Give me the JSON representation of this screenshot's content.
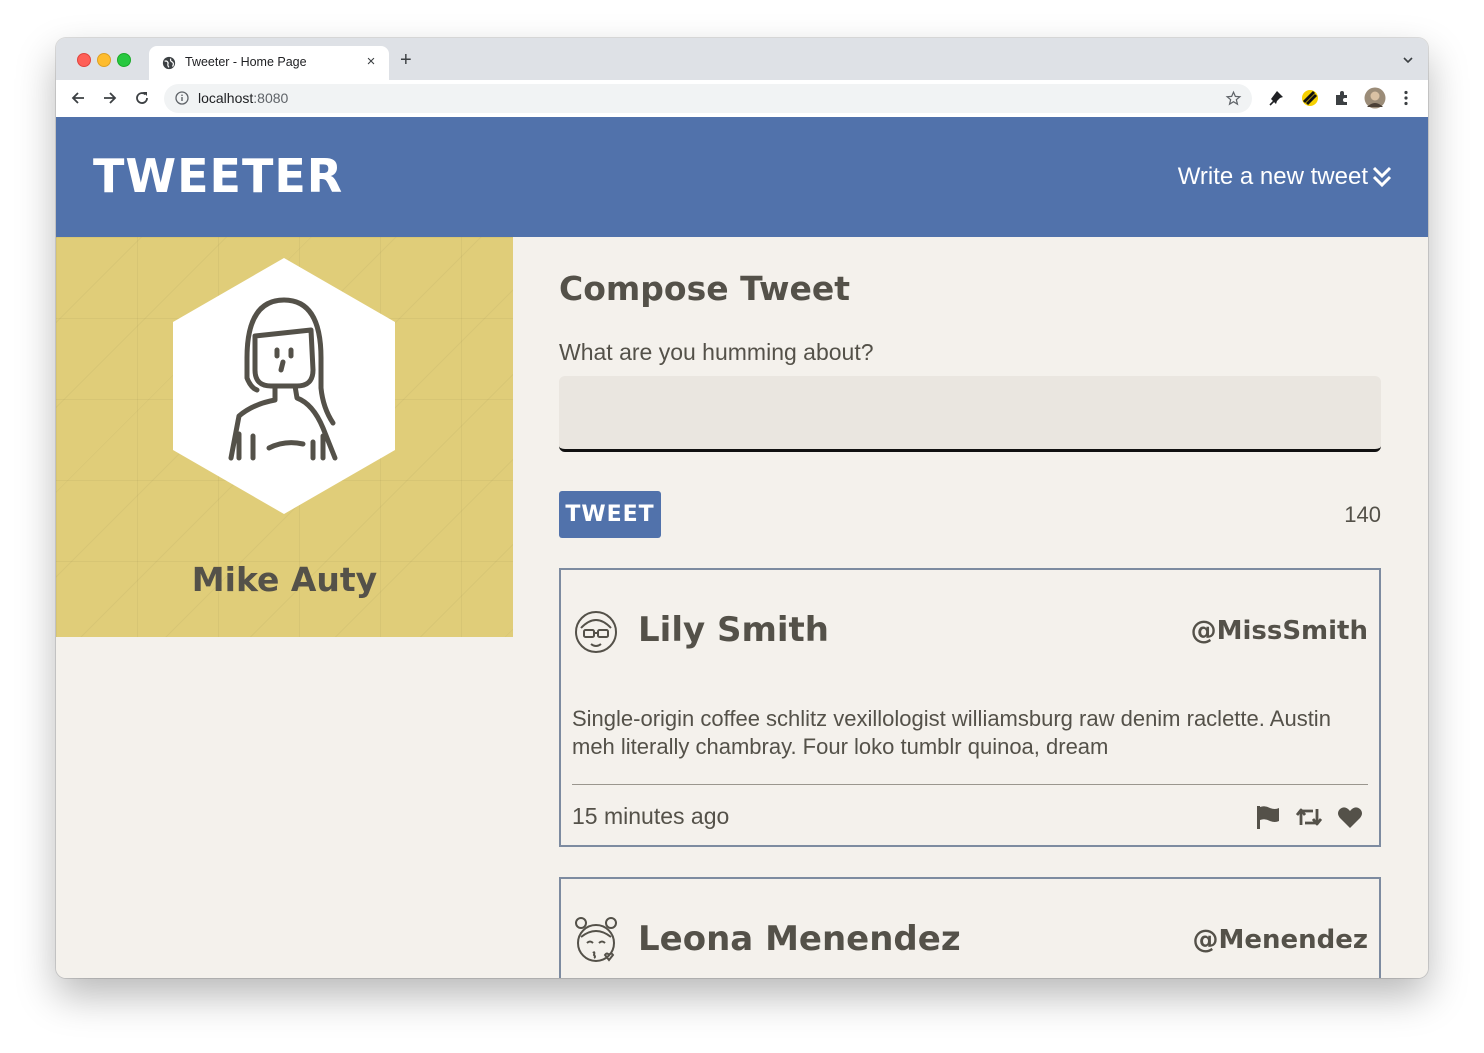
{
  "browser": {
    "tab_title": "Tweeter - Home Page",
    "url_host": "localhost",
    "url_port": ":8080",
    "new_tab_label": "+",
    "close_tab_label": "×"
  },
  "header": {
    "logo": "TWEETER",
    "write_new": "Write a new tweet"
  },
  "profile": {
    "name": "Mike Auty"
  },
  "compose": {
    "title": "Compose Tweet",
    "label": "What are you humming about?",
    "input_value": "",
    "tweet_button": "TWEET",
    "counter": "140"
  },
  "tweets": [
    {
      "name": "Lily Smith",
      "handle": "@MissSmith",
      "text": "Single-origin coffee schlitz vexillologist williamsburg raw denim raclette. Austin meh literally chambray. Four loko tumblr quinoa, dream",
      "time": "15 minutes ago"
    },
    {
      "name": "Leona Menendez",
      "handle": "@Menendez"
    }
  ],
  "colors": {
    "header_bg": "#5172ab",
    "profile_bg": "#e0cd79",
    "page_bg": "#f4f1ec",
    "text": "#545149",
    "tweet_border": "#7d8ba0"
  }
}
